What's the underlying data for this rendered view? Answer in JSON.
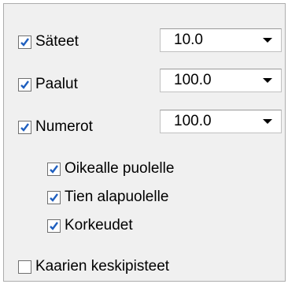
{
  "options": {
    "sateet": {
      "label": "Säteet",
      "checked": true,
      "value": "10.0"
    },
    "paalut": {
      "label": "Paalut",
      "checked": true,
      "value": "100.0"
    },
    "numerot": {
      "label": "Numerot",
      "checked": true,
      "value": "100.0"
    },
    "oikealle": {
      "label": "Oikealle puolelle",
      "checked": true
    },
    "alapuolelle": {
      "label": "Tien alapuolelle",
      "checked": true
    },
    "korkeudet": {
      "label": "Korkeudet",
      "checked": true
    },
    "kaarien": {
      "label": "Kaarien keskipisteet",
      "checked": false
    }
  },
  "colors": {
    "check": "#1f5fbf",
    "panel": "#f0f0f0",
    "border": "#adadad"
  }
}
